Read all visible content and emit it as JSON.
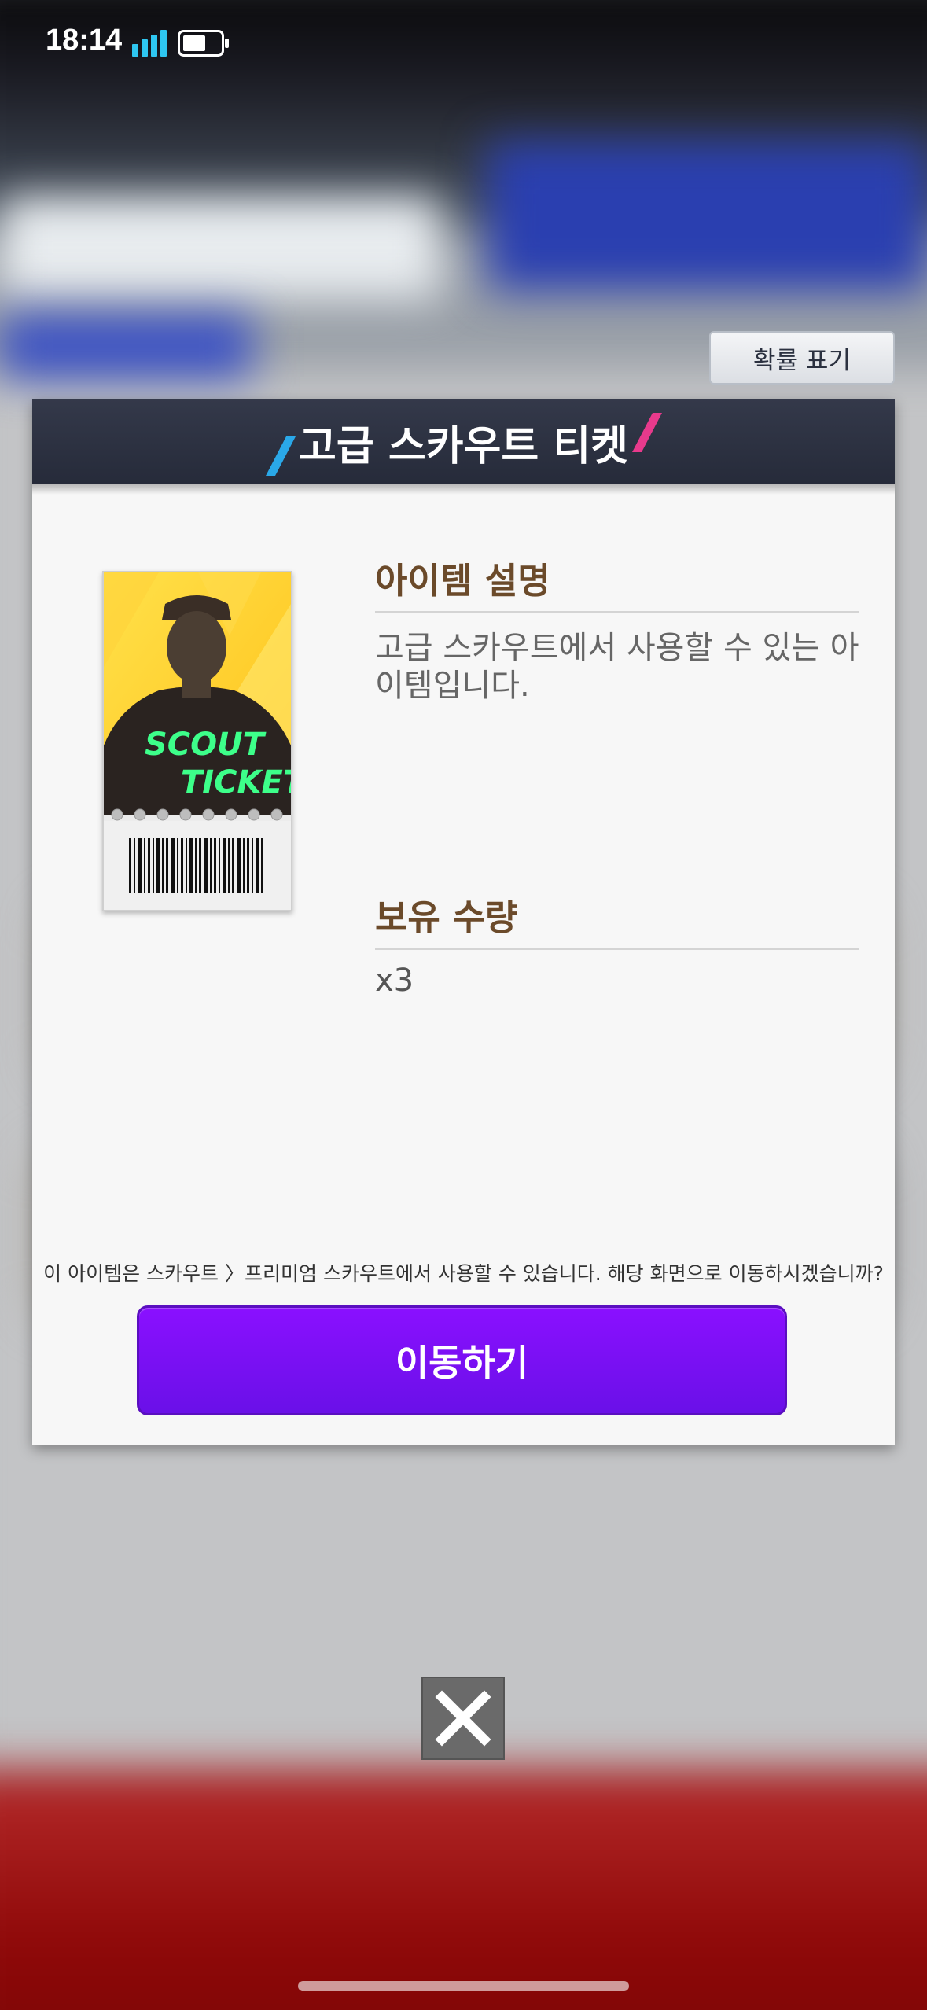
{
  "status_bar": {
    "time": "18:14"
  },
  "probability_button": {
    "label": "확률 표기"
  },
  "modal": {
    "title": "고급 스카우트 티켓",
    "item_image": {
      "line1": "SCOUT",
      "line2": "TICKET"
    },
    "description": {
      "heading": "아이템 설명",
      "text": "고급 스카우트에서 사용할 수 있는 아이템입니다."
    },
    "owned": {
      "heading": "보유 수량",
      "value": "x3"
    },
    "notice": "이 아이템은 스카우트 〉프리미엄 스카우트에서 사용할 수 있습니다. 해당 화면으로 이동하시겠습니까?",
    "go_button": "이동하기"
  },
  "colors": {
    "header_bg": "#2b3040",
    "section_heading": "#6b4a2a",
    "go_button": "#7a10f0",
    "slash_left": "#2aa8e8",
    "slash_right": "#e83a8c"
  },
  "icons": [
    "signal-icon",
    "battery-icon",
    "close-icon"
  ]
}
